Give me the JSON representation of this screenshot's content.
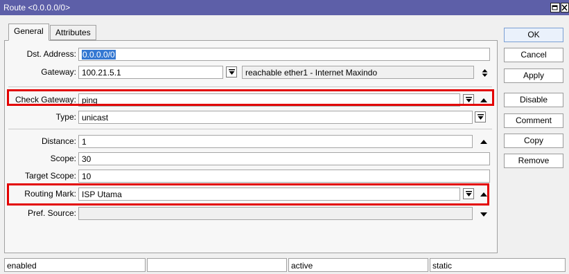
{
  "window": {
    "title": "Route <0.0.0.0/0>"
  },
  "tabs": [
    {
      "label": "General",
      "active": true
    },
    {
      "label": "Attributes",
      "active": false
    }
  ],
  "form": {
    "dst_address": {
      "label": "Dst. Address:",
      "value": "0.0.0.0/0"
    },
    "gateway": {
      "label": "Gateway:",
      "value": "100.21.5.1",
      "status": "reachable ether1 - Internet Maxindo"
    },
    "check_gateway": {
      "label": "Check Gateway:",
      "value": "ping"
    },
    "type": {
      "label": "Type:",
      "value": "unicast"
    },
    "distance": {
      "label": "Distance:",
      "value": "1"
    },
    "scope": {
      "label": "Scope:",
      "value": "30"
    },
    "target_scope": {
      "label": "Target Scope:",
      "value": "10"
    },
    "routing_mark": {
      "label": "Routing Mark:",
      "value": "ISP Utama"
    },
    "pref_source": {
      "label": "Pref. Source:",
      "value": ""
    }
  },
  "buttons": {
    "ok": "OK",
    "cancel": "Cancel",
    "apply": "Apply",
    "disable": "Disable",
    "comment": "Comment",
    "copy": "Copy",
    "remove": "Remove"
  },
  "status": {
    "state": "enabled",
    "empty": "",
    "activity": "active",
    "kind": "static"
  },
  "colors": {
    "title_bar": "#5d5fa8",
    "highlight_box": "#e30000",
    "selection": "#3478d2"
  },
  "icons": {
    "dropdown": "dropdown-arrow-icon",
    "collapse": "collapse-up-icon",
    "expand": "expand-down-icon",
    "spinner": "up-down-spinner-icon",
    "restore": "restore-window-icon",
    "close": "close-icon"
  }
}
